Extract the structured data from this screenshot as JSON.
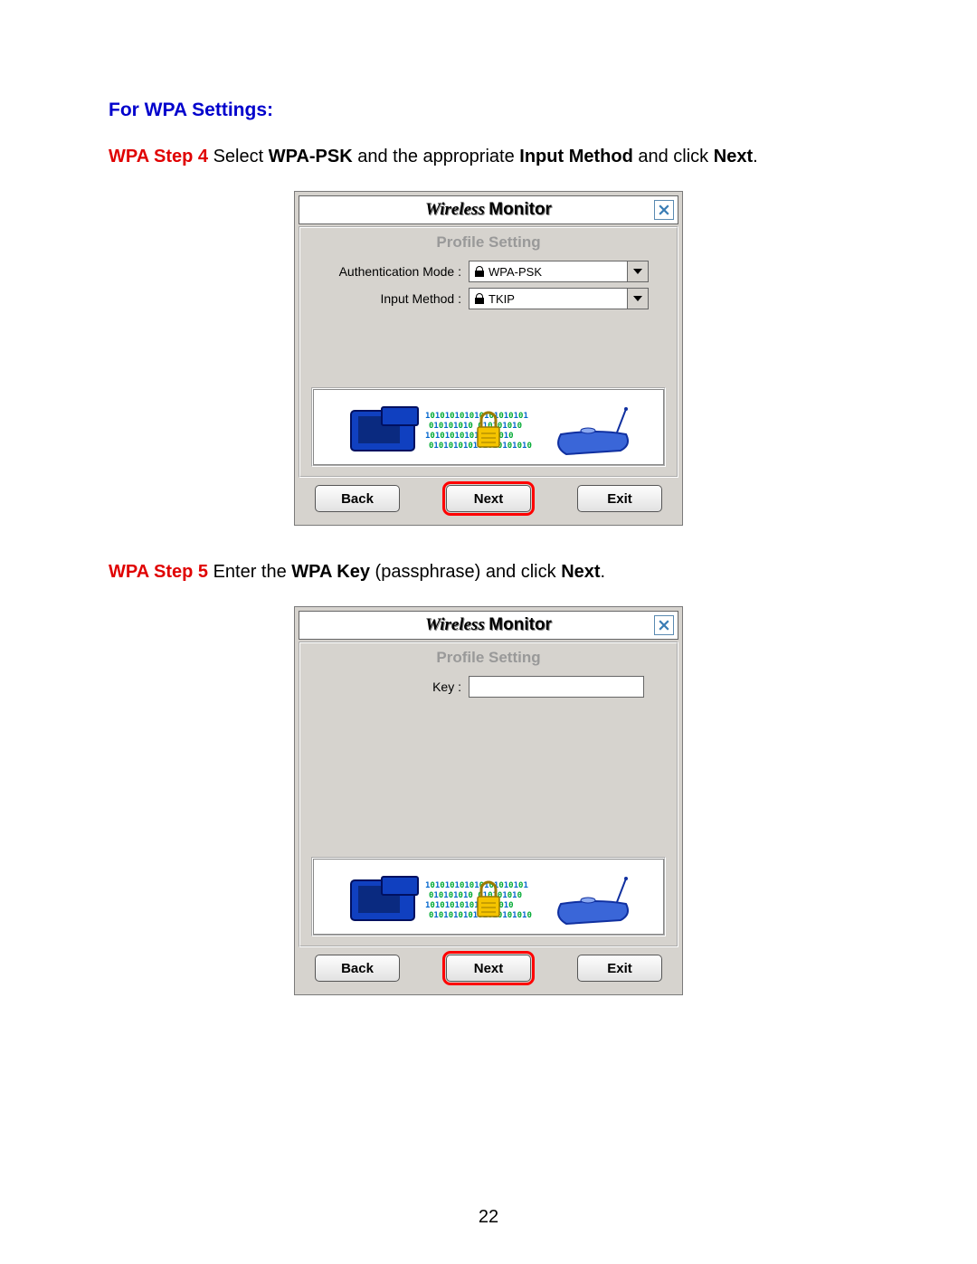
{
  "heading": "For WPA Settings:",
  "step4": {
    "tag": "WPA Step 4",
    "t1": " Select ",
    "b1": "WPA-PSK",
    "t2": " and the appropriate ",
    "b2": "Input Method",
    "t3": " and click ",
    "b3": "Next",
    "t4": "."
  },
  "step5": {
    "tag": "WPA Step 5",
    "t1": " Enter the ",
    "b1": "WPA Key",
    "t2": " (passphrase) and click ",
    "b2": "Next",
    "t3": "."
  },
  "dialog": {
    "title_wireless": "Wireless",
    "title_monitor": "Monitor",
    "panel_title": "Profile Setting",
    "auth_label": "Authentication Mode :",
    "auth_value": "WPA-PSK",
    "input_label": "Input Method :",
    "input_value": "TKIP",
    "key_label": "Key :",
    "key_value": "",
    "back": "Back",
    "next": "Next",
    "exit": "Exit"
  },
  "page_number": "22"
}
